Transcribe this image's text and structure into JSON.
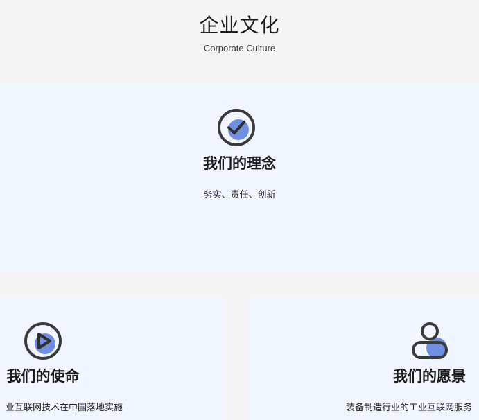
{
  "header": {
    "title": "企业文化",
    "subtitle": "Corporate Culture"
  },
  "colors": {
    "page_bg": "#f4f4f4",
    "card_bg": "#f1f5ff",
    "icon_accent": "#6f8fe0",
    "icon_stroke": "#3a3a3a"
  },
  "cards": {
    "philosophy": {
      "icon": "check-circle-icon",
      "title": "我们的理念",
      "text": "务实、责任、创新"
    },
    "mission": {
      "icon": "play-circle-icon",
      "title": "我们的使命",
      "text": "业互联网技术在中国落地实施"
    },
    "vision": {
      "icon": "user-icon",
      "title": "我们的愿景",
      "text": "装备制造行业的工业互联网服务"
    }
  }
}
